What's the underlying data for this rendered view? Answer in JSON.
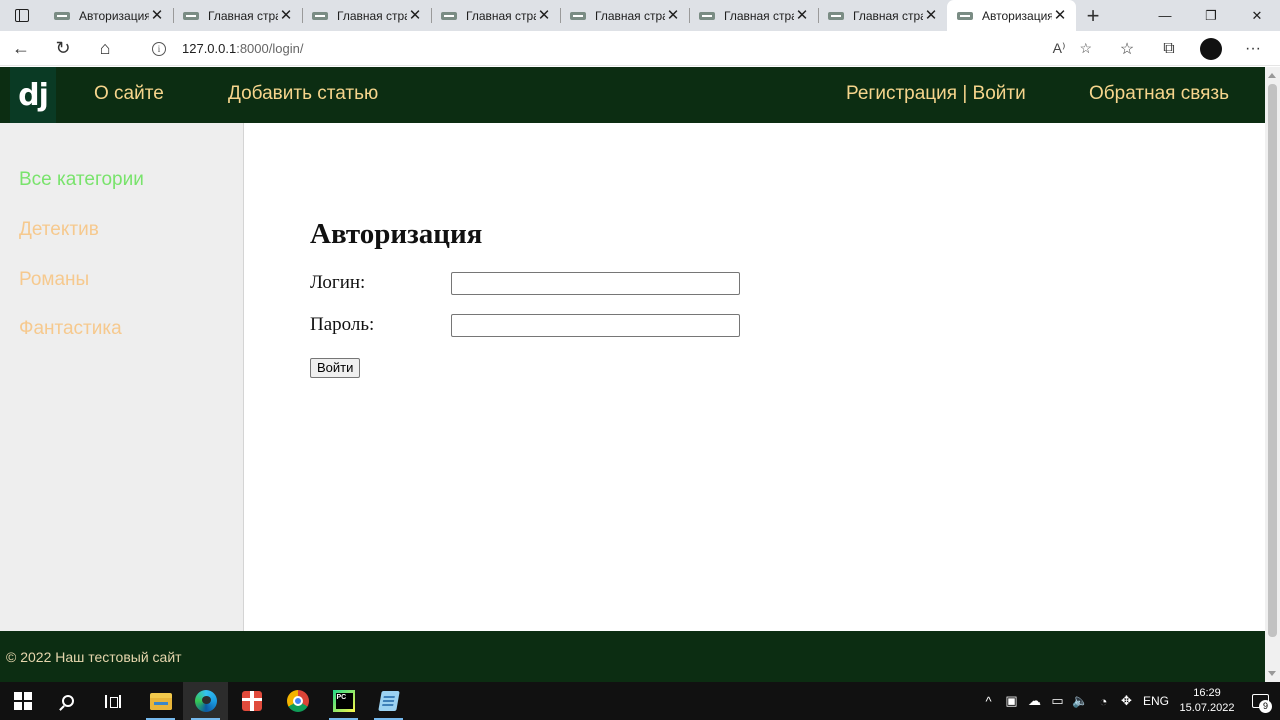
{
  "browser": {
    "tabs": [
      {
        "title": "Авторизация",
        "active": false
      },
      {
        "title": "Главная страница",
        "active": false
      },
      {
        "title": "Главная страница",
        "active": false
      },
      {
        "title": "Главная страница",
        "active": false
      },
      {
        "title": "Главная страница",
        "active": false
      },
      {
        "title": "Главная страница",
        "active": false
      },
      {
        "title": "Главная страница",
        "active": false
      },
      {
        "title": "Авторизация",
        "active": true
      }
    ],
    "tab_close_glyph": "✕",
    "new_tab_glyph": "+",
    "url_host": "127.0.0.1",
    "url_rest": ":8000/login/",
    "read_aloud_label": "A⁾",
    "window_controls": {
      "minimize": "—",
      "maximize": "❐",
      "close": "✕"
    },
    "toolbar_icons": {
      "back": "←",
      "reload": "↻",
      "home": "⌂",
      "favorite_add": "☆",
      "favorites": "☆",
      "collections": "⧉",
      "more": "···"
    }
  },
  "site": {
    "logo_text": "dj",
    "nav": {
      "about": "О сайте",
      "add_article": "Добавить статью",
      "auth": "Регистрация | Войти",
      "feedback": "Обратная связь"
    },
    "sidebar": {
      "items": [
        {
          "label": "Все категории",
          "selected": true
        },
        {
          "label": "Детектив",
          "selected": false
        },
        {
          "label": "Романы",
          "selected": false
        },
        {
          "label": "Фантастика",
          "selected": false
        }
      ]
    },
    "login_form": {
      "title": "Авторизация",
      "login_label": "Логин:",
      "login_value": "",
      "password_label": "Пароль:",
      "password_value": "",
      "submit_label": "Войти"
    },
    "footer": {
      "copyright": "© 2022 Наш тестовый сайт"
    },
    "colors": {
      "header_bg": "#0c2d12",
      "nav_link": "#f6d58c",
      "category_selected": "#79e36c",
      "category_default": "#f6c98e"
    }
  },
  "taskbar": {
    "apps": [
      "windows-start",
      "search",
      "task-view",
      "file-explorer",
      "edge",
      "gift-app",
      "chrome",
      "pycharm",
      "notepad"
    ],
    "tray": {
      "language": "ENG",
      "time": "16:29",
      "date": "15.07.2022",
      "notification_count": "9",
      "icons": {
        "chevron": "^",
        "meet": "▣",
        "onedrive": "☁",
        "battery": "▭",
        "volume": "🔈",
        "network": "◔",
        "dropbox": "✥"
      }
    }
  }
}
